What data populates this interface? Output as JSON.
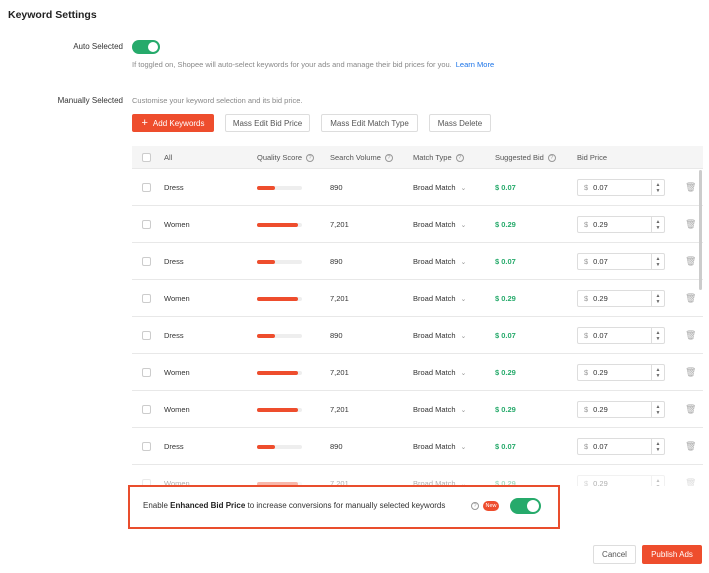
{
  "page": {
    "title": "Keyword Settings"
  },
  "auto": {
    "label": "Auto Selected",
    "hint": "If toggled on, Shopee will auto-select keywords for your ads and manage their bid prices for you.",
    "learn_more": "Learn More",
    "enabled": true
  },
  "manual": {
    "label": "Manually Selected",
    "hint": "Customise your keyword selection and its bid price."
  },
  "toolbar": {
    "add_plus": "+",
    "add_keywords": "Add Keywords",
    "mass_edit_bid": "Mass Edit Bid Price",
    "mass_edit_match": "Mass Edit Match Type",
    "mass_delete": "Mass Delete"
  },
  "table": {
    "headers": {
      "all": "All",
      "quality": "Quality Score",
      "volume": "Search Volume",
      "match": "Match Type",
      "suggested": "Suggested Bid",
      "bid": "Bid Price"
    },
    "rows": [
      {
        "keyword": "Dress",
        "quality": 0.4,
        "volume": "890",
        "match": "Broad Match",
        "suggested": "$ 0.07",
        "currency": "$",
        "bid": "0.07"
      },
      {
        "keyword": "Women",
        "quality": 0.9,
        "volume": "7,201",
        "match": "Broad Match",
        "suggested": "$ 0.29",
        "currency": "$",
        "bid": "0.29"
      },
      {
        "keyword": "Dress",
        "quality": 0.4,
        "volume": "890",
        "match": "Broad Match",
        "suggested": "$ 0.07",
        "currency": "$",
        "bid": "0.07"
      },
      {
        "keyword": "Women",
        "quality": 0.9,
        "volume": "7,201",
        "match": "Broad Match",
        "suggested": "$ 0.29",
        "currency": "$",
        "bid": "0.29"
      },
      {
        "keyword": "Dress",
        "quality": 0.4,
        "volume": "890",
        "match": "Broad Match",
        "suggested": "$ 0.07",
        "currency": "$",
        "bid": "0.07"
      },
      {
        "keyword": "Women",
        "quality": 0.9,
        "volume": "7,201",
        "match": "Broad Match",
        "suggested": "$ 0.29",
        "currency": "$",
        "bid": "0.29"
      },
      {
        "keyword": "Women",
        "quality": 0.9,
        "volume": "7,201",
        "match": "Broad Match",
        "suggested": "$ 0.29",
        "currency": "$",
        "bid": "0.29"
      },
      {
        "keyword": "Dress",
        "quality": 0.4,
        "volume": "890",
        "match": "Broad Match",
        "suggested": "$ 0.07",
        "currency": "$",
        "bid": "0.07"
      },
      {
        "keyword": "Women",
        "quality": 0.9,
        "volume": "7,201",
        "match": "Broad Match",
        "suggested": "$ 0.29",
        "currency": "$",
        "bid": "0.29"
      }
    ]
  },
  "enhanced": {
    "prefix": "Enable ",
    "bold": "Enhanced Bid Price",
    "suffix": " to increase conversions for manually selected keywords",
    "badge": "New",
    "enabled": true
  },
  "footer": {
    "cancel": "Cancel",
    "publish": "Publish Ads"
  },
  "colors": {
    "accent": "#ee4d2d",
    "toggle_on": "#26aa6b",
    "suggested": "#26aa6b",
    "link": "#1a73e8"
  },
  "icons": {
    "help": "question-circle-icon",
    "delete": "trash-icon",
    "dropdown": "chevron-down-icon"
  }
}
